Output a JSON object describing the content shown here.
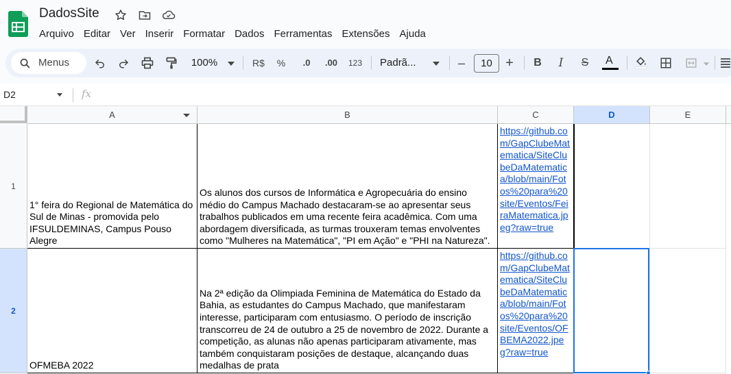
{
  "app": {
    "doc_title": "DadosSite",
    "brand_color": "#0f9d58"
  },
  "menu": [
    "Arquivo",
    "Editar",
    "Ver",
    "Inserir",
    "Formatar",
    "Dados",
    "Ferramentas",
    "Extensões",
    "Ajuda"
  ],
  "toolbar": {
    "search_label": "Menus",
    "zoom": "100%",
    "currency": "R$",
    "percent": "%",
    "dec_decrease": ".0",
    "dec_increase": ".00",
    "number_format": "123",
    "font_name": "Padrã...",
    "font_size": "10",
    "minus": "–",
    "plus": "+",
    "bold": "B",
    "italic": "I",
    "strike": "S",
    "text_color_letter": "A"
  },
  "formula_bar": {
    "name_box": "D2",
    "fx": "fx",
    "formula": ""
  },
  "columns": [
    "A",
    "B",
    "C",
    "D",
    "E"
  ],
  "selected_column": "D",
  "selected_cell": "D2",
  "rows": [
    {
      "num": "1",
      "a": "1° feira do Regional de Matemática do Sul de Minas - promovida pelo IFSULDEMINAS, Campus Pouso Alegre",
      "b": "Os alunos dos cursos de Informática e Agropecuária do ensino médio do Campus Machado destacaram-se ao apresentar seus trabalhos publicados em uma recente feira acadêmica. Com uma abordagem diversificada, as turmas trouxeram temas envolventes como \"Mulheres na Matemática\", \"PI em Ação\" e \"PHI na Natureza\".",
      "c": "https://github.com/GapClubeMatematica/SiteClubeDaMatematica/blob/main/Fotos%20para%20site/Eventos/FeiraMatematica.jpeg?raw=true",
      "d": "",
      "e": ""
    },
    {
      "num": "2",
      "a": "OFMEBA 2022",
      "b": "Na 2ª edição da Olimpiada Feminina de Matemática do Estado da Bahia, as estudantes do Campus Machado, que manifestaram interesse, participaram com entusiasmo. O período de inscrição transcorreu de 24 de outubro a 25 de novembro de 2022. Durante a competição, as alunas não apenas participaram ativamente, mas também conquistaram posições de destaque, alcançando duas medalhas de prata",
      "c": "https://github.com/GapClubeMatematica/SiteClubeDaMatematica/blob/main/Fotos%20para%20site/Eventos/OFBEMA2022.jpeg?raw=true",
      "d": "",
      "e": ""
    }
  ],
  "colors": {
    "accent": "#1a73e8",
    "link": "#1155cc",
    "selected_header_bg": "#d3e3fd",
    "toolbar_bg": "#edf2fa"
  }
}
